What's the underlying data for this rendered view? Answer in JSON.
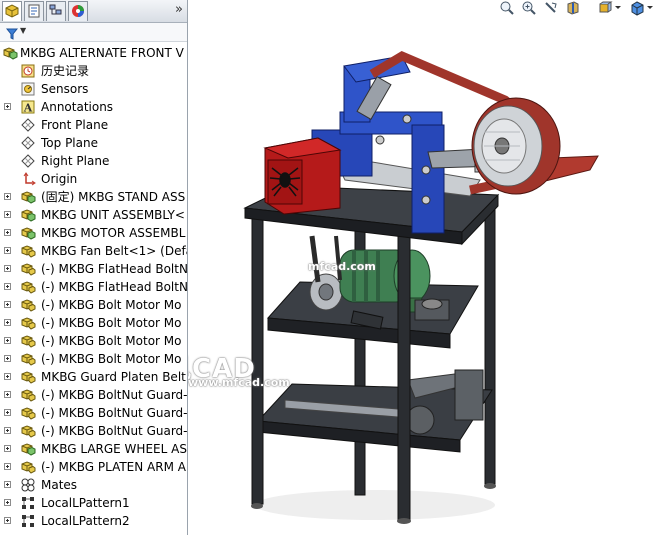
{
  "feature_tree": {
    "items": [
      {
        "label": "MKBG ALTERNATE FRONT V",
        "icon": "assembly-icon"
      },
      {
        "label": "历史记录",
        "icon": "history-icon"
      },
      {
        "label": "Sensors",
        "icon": "sensors-icon"
      },
      {
        "label": "Annotations",
        "icon": "annotations-icon"
      },
      {
        "label": "Front Plane",
        "icon": "plane-icon"
      },
      {
        "label": "Top Plane",
        "icon": "plane-icon"
      },
      {
        "label": "Right Plane",
        "icon": "plane-icon"
      },
      {
        "label": "Origin",
        "icon": "origin-icon"
      },
      {
        "label": "(固定) MKBG STAND ASS",
        "icon": "assembly-icon"
      },
      {
        "label": "MKBG UNIT ASSEMBLY<",
        "icon": "assembly-icon"
      },
      {
        "label": "MKBG MOTOR ASSEMBL",
        "icon": "assembly-icon"
      },
      {
        "label": "MKBG Fan Belt<1> (Defa",
        "icon": "part-icon"
      },
      {
        "label": "(-) MKBG FlatHead BoltN",
        "icon": "part-icon"
      },
      {
        "label": "(-) MKBG FlatHead BoltN",
        "icon": "part-icon"
      },
      {
        "label": "(-) MKBG Bolt Motor Mo",
        "icon": "part-icon"
      },
      {
        "label": "(-) MKBG Bolt Motor Mo",
        "icon": "part-icon"
      },
      {
        "label": "(-) MKBG Bolt Motor Mo",
        "icon": "part-icon"
      },
      {
        "label": "(-) MKBG Bolt Motor Mo",
        "icon": "part-icon"
      },
      {
        "label": "MKBG Guard Platen Belt",
        "icon": "part-icon"
      },
      {
        "label": "(-) MKBG BoltNut Guard-",
        "icon": "part-icon"
      },
      {
        "label": "(-) MKBG BoltNut Guard-",
        "icon": "part-icon"
      },
      {
        "label": "(-) MKBG BoltNut Guard-",
        "icon": "part-icon"
      },
      {
        "label": "MKBG LARGE WHEEL ASS",
        "icon": "assembly-icon"
      },
      {
        "label": "(-) MKBG PLATEN ARM A",
        "icon": "part-icon"
      },
      {
        "label": "Mates",
        "icon": "mates-icon"
      },
      {
        "label": "LocalLPattern1",
        "icon": "pattern-icon"
      },
      {
        "label": "LocalLPattern2",
        "icon": "pattern-icon"
      }
    ]
  },
  "panel_tabs": [
    "featuremanager-tab-icon",
    "propertymanager-tab-icon",
    "configurationmanager-tab-icon",
    "display-manager-tab-icon"
  ],
  "tab_more": "»",
  "view_toolbar": [
    "zoom-to-fit-icon",
    "zoom-to-area-icon",
    "previous-view-icon",
    "section-view-icon",
    "view-orientation-icon",
    "display-style-icon"
  ],
  "watermarks": {
    "upper": "mfcad.com",
    "brand": "沐风CAD",
    "lower": "www.mfcad.com"
  },
  "model": {
    "name": "2x72 belt grinder on stand",
    "frame_color": "#2c2f33",
    "unit_color": "#2747b8",
    "belt_color": "#a0352b",
    "motor_color": "#3f7f52",
    "guard_color": "#b51a1a",
    "wheel_color": "#cfd3d7"
  }
}
